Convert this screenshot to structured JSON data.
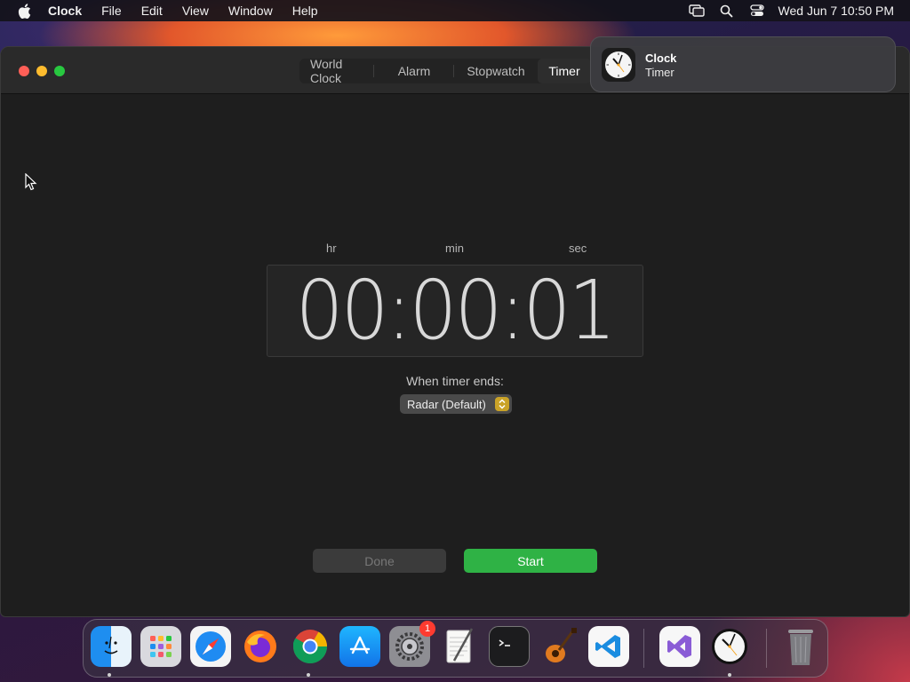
{
  "menubar": {
    "app_name": "Clock",
    "items": [
      "File",
      "Edit",
      "View",
      "Window",
      "Help"
    ],
    "datetime": "Wed Jun 7  10:50 PM"
  },
  "window": {
    "tabs": [
      {
        "label": "World Clock",
        "active": false
      },
      {
        "label": "Alarm",
        "active": false
      },
      {
        "label": "Stopwatch",
        "active": false
      },
      {
        "label": "Timer",
        "active": true
      }
    ],
    "units": {
      "hr": "hr",
      "min": "min",
      "sec": "sec"
    },
    "timer_display": "00:00:01",
    "ends_label": "When timer ends:",
    "sound_selected": "Radar (Default)",
    "done_label": "Done",
    "start_label": "Start",
    "colors": {
      "start": "#2fb245",
      "accent_select": "#c9a227"
    }
  },
  "notification": {
    "app": "Clock",
    "body": "Timer"
  },
  "dock": {
    "apps": [
      "Finder",
      "Launchpad",
      "Safari",
      "Firefox",
      "Chrome",
      "App Store",
      "System Settings",
      "TextEdit",
      "Terminal",
      "GarageBand",
      "Visual Studio Code",
      "Visual Studio",
      "Clock",
      "Trash"
    ],
    "settings_badge": "1"
  }
}
